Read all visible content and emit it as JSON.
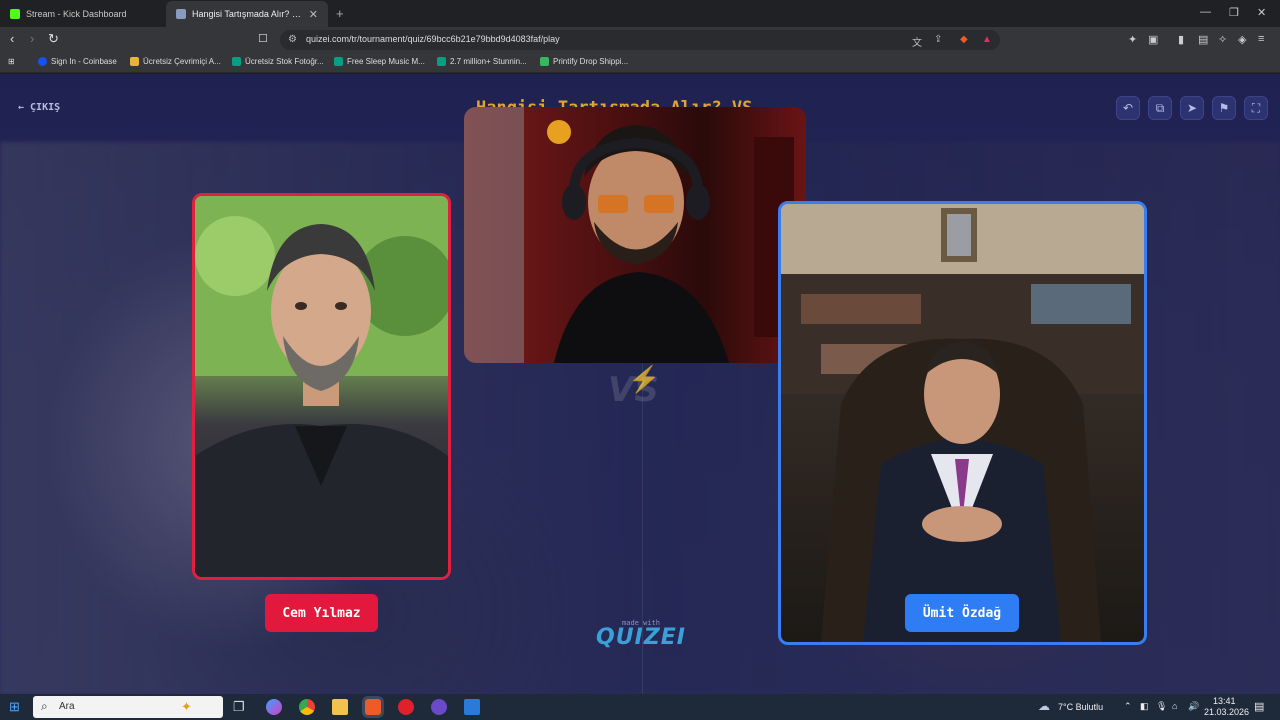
{
  "browser": {
    "tabs": [
      {
        "title": "Stream - Kick Dashboard",
        "favicon_color": "#53fc18"
      },
      {
        "title": "Hangisi Tartışmada Alır? VS - Tie...",
        "favicon_color": "#8a9bbf"
      }
    ],
    "url": "quizei.com/tr/tournament/quiz/69bcc6b21e79bbd9d4083faf/play",
    "bookmarks": [
      {
        "label": "Sign In - Coinbase",
        "color": "#1652f0"
      },
      {
        "label": "Ücretsiz Çevrimiçi A...",
        "color": "#e8b43a"
      },
      {
        "label": "Ücretsiz Stok Fotoğr...",
        "color": "#05a081"
      },
      {
        "label": "Free Sleep Music M...",
        "color": "#05a081"
      },
      {
        "label": "2.7 million+ Stunnin...",
        "color": "#05a081"
      },
      {
        "label": "Printify Drop Shippi...",
        "color": "#39b75d"
      }
    ]
  },
  "page": {
    "exit_label": "ÇIKIŞ",
    "title": "Hangisi Tartışmada Alır? VS",
    "vs_label": "VS",
    "left_name": "Cem Yılmaz",
    "right_name": "Ümit Özdağ",
    "made_with": "made with",
    "brand": "QUIZEI",
    "colors": {
      "left": "#e2193c",
      "right": "#2f7df5",
      "title": "#e2a52c"
    }
  },
  "taskbar": {
    "search_placeholder": "Ara",
    "weather": "7°C Bulutlu",
    "time": "13:41",
    "date": "21.03.2026"
  }
}
